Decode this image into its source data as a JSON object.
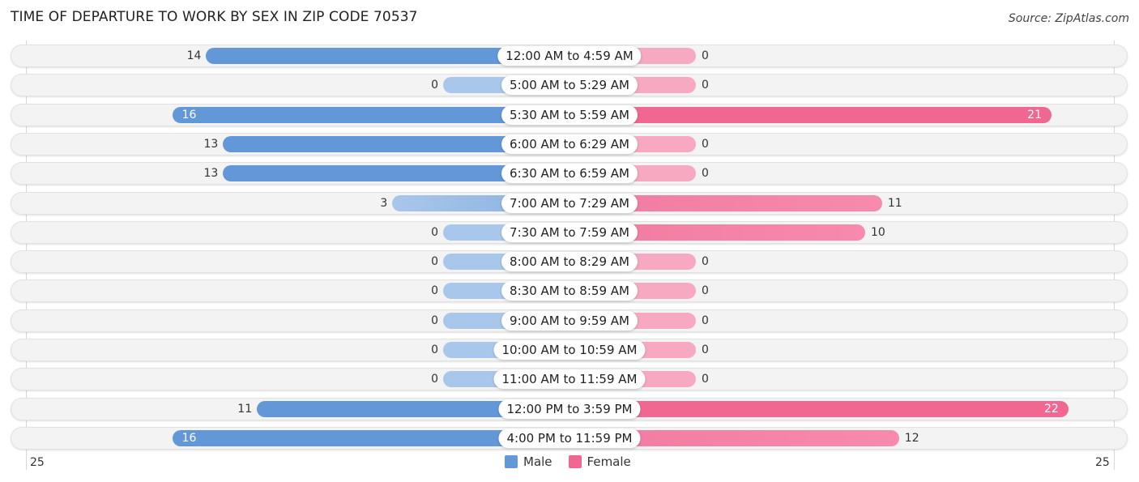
{
  "header": {
    "title": "TIME OF DEPARTURE TO WORK BY SEX IN ZIP CODE 70537",
    "source": "Source: ZipAtlas.com"
  },
  "colors": {
    "male_strong": "#6398d8",
    "male_light": "#a9c7ea",
    "female_strong": "#f06892",
    "female_light": "#f7a9c1"
  },
  "chart_data": {
    "type": "bar",
    "orientation": "horizontal-diverging",
    "title": "TIME OF DEPARTURE TO WORK BY SEX IN ZIP CODE 70537",
    "xlabel": "",
    "ylabel": "",
    "axis_ticks": {
      "left": "25",
      "right": "25"
    },
    "xlim": [
      0,
      25
    ],
    "legend": {
      "position": "bottom-center",
      "entries": [
        "Male",
        "Female"
      ]
    },
    "categories": [
      "12:00 AM to 4:59 AM",
      "5:00 AM to 5:29 AM",
      "5:30 AM to 5:59 AM",
      "6:00 AM to 6:29 AM",
      "6:30 AM to 6:59 AM",
      "7:00 AM to 7:29 AM",
      "7:30 AM to 7:59 AM",
      "8:00 AM to 8:29 AM",
      "8:30 AM to 8:59 AM",
      "9:00 AM to 9:59 AM",
      "10:00 AM to 10:59 AM",
      "11:00 AM to 11:59 AM",
      "12:00 PM to 3:59 PM",
      "4:00 PM to 11:59 PM"
    ],
    "series": [
      {
        "name": "Male",
        "values": [
          14,
          0,
          16,
          13,
          13,
          3,
          0,
          0,
          0,
          0,
          0,
          0,
          11,
          16
        ]
      },
      {
        "name": "Female",
        "values": [
          0,
          0,
          21,
          0,
          0,
          11,
          10,
          0,
          0,
          0,
          0,
          0,
          22,
          12
        ]
      }
    ]
  }
}
